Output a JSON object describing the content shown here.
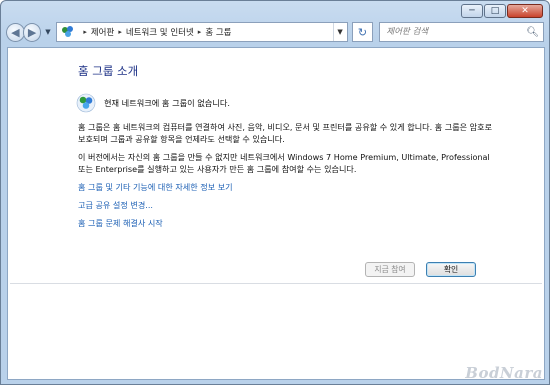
{
  "window": {
    "controls": {
      "minimize": "─",
      "maximize": "□",
      "close": "✕"
    }
  },
  "nav": {
    "back_glyph": "◀",
    "forward_glyph": "▶",
    "dropdown_glyph": "▼",
    "breadcrumbs": [
      "제어판",
      "네트워크 및 인터넷",
      "홈 그룹"
    ],
    "breadcrumb_sep": "▸",
    "refresh_glyph": "↻",
    "search_placeholder": "제어판 검색",
    "search_icon": "search-icon"
  },
  "main": {
    "title": "홈 그룹 소개",
    "status_text": "현재 네트워크에 홈 그룹이 없습니다.",
    "paragraph1": "홈 그룹은 홈 네트워크의 컴퓨터를 연결하여 사진, 음악, 비디오, 문서 및 프린터를 공유할 수 있게 합니다. 홈 그룹은 암호로 보호되며 그룹과 공유할 항목을 언제라도 선택할 수 있습니다.",
    "paragraph2": "이 버전에서는 자신의 홈 그룹을 만들 수 없지만 네트워크에서 Windows 7 Home Premium, Ultimate, Professional 또는 Enterprise를 실행하고 있는 사용자가 만든 홈 그룹에 참여할 수는 있습니다.",
    "links": [
      "홈 그룹 및 기타 기능에 대한 자세한 정보 보기",
      "고급 공유 설정 변경...",
      "홈 그룹 문제 해결사 시작"
    ],
    "buttons": {
      "join": "지금 참여",
      "ok": "확인"
    }
  },
  "watermark": "BodNara",
  "colors": {
    "title": "#1e3287",
    "link": "#1b5fb4",
    "frame": "#b9d1ea"
  }
}
